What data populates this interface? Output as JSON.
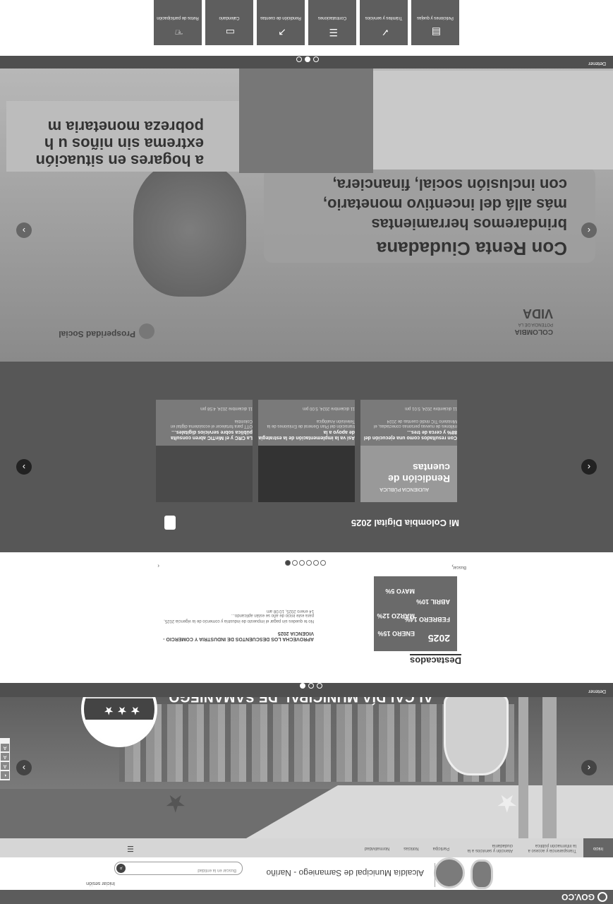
{
  "gov": {
    "label": "GOV.CO"
  },
  "header": {
    "title": "Alcaldía Municipal de Samaniego - Nariño",
    "login": "Iniciar sesión",
    "search_placeholder": "Buscar en la entidad",
    "search_icon": "search-icon"
  },
  "nav": {
    "home": "Inicio",
    "items": [
      "Transparencia y acceso a la información pública",
      "Atención y servicios a la ciudadanía",
      "Participa",
      "Noticias",
      "Normatividad"
    ],
    "menu_icon": "hamburger-icon"
  },
  "hero": {
    "title": "ALCALDÍA MUNICIPAL DE SAMANIEGO",
    "stop": "Detener",
    "accessibility": [
      "A",
      "A",
      "A",
      "◐"
    ]
  },
  "destacados": {
    "heading": "Destacados",
    "news_title": "APROVECHA LOS DESCUENTOS DE INDUSTRIA Y COMERCIO - VIGENCIA 2025",
    "news_body": "No te quedes sin pagar el impuesto de industria y comercio de la vigencia 2025, para este inicio de año se están aplicando...",
    "news_time": "14 enero 2025, 10:08 am",
    "poster": {
      "year": "2025",
      "m1": "ENERO 15%",
      "m2": "FEBRERO 14%",
      "m3": "MARZO 12%",
      "m4": "ABRIL 10%",
      "m5": "MAYO 5%"
    },
    "nav_label": "Buscar"
  },
  "mcd": {
    "heading": "Mi Colombia Digital 2025",
    "cards": [
      {
        "title": "La CRC y el MinTIC abren consulta pública sobre servicios digitales…",
        "body": "OTT para fortalecer el ecosistema digital en Colombia",
        "date": "11 diciembre 2024, 4:58 pm"
      },
      {
        "title": "Así va la implementación de la estrategia de apoyo a la",
        "body": "transición del Plan General de Emisiones de la Televisión Analógica",
        "date": "11 diciembre 2024, 5:00 pm"
      },
      {
        "title": "Con resultados como una ejecución del 88% y cerca de tres...",
        "body": "millones de nuevas personas conectadas, el Ministerio TIC rindió cuentas de 2024",
        "date": "11 diciembre 2024, 5:01 pm"
      }
    ],
    "card3_img": "Rendición de cuentas",
    "card3_top": "AUDIENCIA PÚBLICA"
  },
  "hero2": {
    "logo": "Prosperidad Social",
    "colombia": "COLOMBIA",
    "potencia": "POTENCIA DE LA",
    "vida": "VIDA",
    "line1": "Con Renta Ciudadana",
    "line2": "brindaremos herramientas",
    "line3": "más allá del incentivo monetario,",
    "line4": "con inclusión social, financiera,",
    "line5": "a hogares en situación",
    "line6": "extrema sin niños u h",
    "line7": "pobreza monetaria m",
    "stop": "Detener"
  },
  "tiles": [
    {
      "label": "Peticiones y quejas",
      "icon": "document-icon"
    },
    {
      "label": "Trámites y servicios",
      "icon": "check-icon"
    },
    {
      "label": "Contrataciones",
      "icon": "list-icon"
    },
    {
      "label": "Rendición de cuentas",
      "icon": "chart-icon"
    },
    {
      "label": "Calendario",
      "icon": "calendar-icon"
    },
    {
      "label": "Retos de participación",
      "icon": "hand-icon"
    }
  ]
}
